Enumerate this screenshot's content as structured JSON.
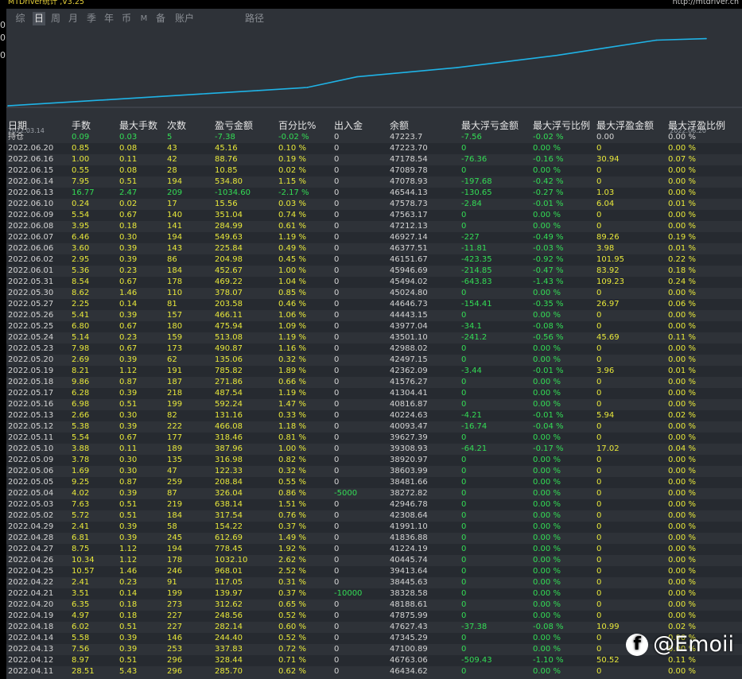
{
  "app": {
    "title": "MTDriver统计 ,V3.25",
    "url": "http://mtdriver.cn"
  },
  "side_labels": [
    "0",
    "0",
    "0"
  ],
  "tabs": [
    {
      "label": "综",
      "active": false
    },
    {
      "label": "日",
      "active": true
    },
    {
      "label": "周",
      "active": false
    },
    {
      "label": "月",
      "active": false
    },
    {
      "label": "季",
      "active": false
    },
    {
      "label": "年",
      "active": false
    },
    {
      "label": "币",
      "active": false
    },
    {
      "label": "M",
      "active": false
    },
    {
      "label": "备",
      "active": false
    },
    {
      "label": "账户",
      "active": false
    },
    {
      "label": "路径",
      "active": false
    }
  ],
  "chart_data": {
    "type": "line",
    "start_label": "2022.03.14",
    "end_label": "2022.06.20",
    "line_color": "#1fb3e6",
    "x": [
      "2022.03.14",
      "2022.03.21",
      "2022.03.28",
      "2022.04.04",
      "2022.04.11",
      "2022.04.18",
      "2022.04.25",
      "2022.05.02",
      "2022.05.09",
      "2022.05.16",
      "2022.05.23",
      "2022.05.30",
      "2022.06.06",
      "2022.06.13",
      "2022.06.20"
    ],
    "series": [
      {
        "values": [
          0.02,
          0.06,
          0.1,
          0.14,
          0.18,
          0.22,
          0.26,
          0.4,
          0.46,
          0.52,
          0.6,
          0.68,
          0.78,
          0.88,
          0.9
        ]
      }
    ]
  },
  "columns": [
    "日期",
    "手数",
    "最大手数",
    "次数",
    "盈亏金额",
    "百分比%",
    "出入金",
    "余额",
    "最大浮亏金额",
    "最大浮亏比例",
    "最大浮盈金额",
    "最大浮盈比例"
  ],
  "colors": {
    "yellow": "#e8e83a",
    "green": "#33dd55",
    "white": "#d4d4d4"
  },
  "rows": [
    [
      "持仓",
      "0.09",
      "0.03",
      "5",
      "-7.38",
      "-0.02 %",
      "0",
      "47223.7",
      "-7.56",
      "-0.02 %",
      "0.00",
      "0.00 %"
    ],
    [
      "2022.06.20",
      "0.85",
      "0.08",
      "43",
      "45.16",
      "0.10 %",
      "0",
      "47223.70",
      "0",
      "0.00 %",
      "0",
      "0.00 %"
    ],
    [
      "2022.06.16",
      "1.00",
      "0.11",
      "42",
      "88.76",
      "0.19 %",
      "0",
      "47178.54",
      "-76.36",
      "-0.16 %",
      "30.94",
      "0.07 %"
    ],
    [
      "2022.06.15",
      "0.55",
      "0.08",
      "28",
      "10.85",
      "0.02 %",
      "0",
      "47089.78",
      "0",
      "0.00 %",
      "0",
      "0.00 %"
    ],
    [
      "2022.06.14",
      "7.95",
      "0.51",
      "194",
      "534.80",
      "1.15 %",
      "0",
      "47078.93",
      "-197.68",
      "-0.42 %",
      "0",
      "0.00 %"
    ],
    [
      "2022.06.13",
      "16.77",
      "2.47",
      "209",
      "-1034.60",
      "-2.17 %",
      "0",
      "46544.13",
      "-130.65",
      "-0.27 %",
      "1.03",
      "0.00 %"
    ],
    [
      "2022.06.10",
      "0.24",
      "0.02",
      "17",
      "15.56",
      "0.03 %",
      "0",
      "47578.73",
      "-2.84",
      "-0.01 %",
      "6.04",
      "0.01 %"
    ],
    [
      "2022.06.09",
      "5.54",
      "0.67",
      "140",
      "351.04",
      "0.74 %",
      "0",
      "47563.17",
      "0",
      "0.00 %",
      "0",
      "0.00 %"
    ],
    [
      "2022.06.08",
      "3.95",
      "0.18",
      "141",
      "284.99",
      "0.61 %",
      "0",
      "47212.13",
      "0",
      "0.00 %",
      "0",
      "0.00 %"
    ],
    [
      "2022.06.07",
      "6.46",
      "0.30",
      "194",
      "549.63",
      "1.19 %",
      "0",
      "46927.14",
      "-227",
      "-0.49 %",
      "89.26",
      "0.19 %"
    ],
    [
      "2022.06.06",
      "3.60",
      "0.39",
      "143",
      "225.84",
      "0.49 %",
      "0",
      "46377.51",
      "-11.81",
      "-0.03 %",
      "3.98",
      "0.01 %"
    ],
    [
      "2022.06.02",
      "2.95",
      "0.39",
      "86",
      "204.98",
      "0.45 %",
      "0",
      "46151.67",
      "-423.35",
      "-0.92 %",
      "101.95",
      "0.22 %"
    ],
    [
      "2022.06.01",
      "5.36",
      "0.23",
      "184",
      "452.67",
      "1.00 %",
      "0",
      "45946.69",
      "-214.85",
      "-0.47 %",
      "83.92",
      "0.18 %"
    ],
    [
      "2022.05.31",
      "8.54",
      "0.67",
      "178",
      "469.22",
      "1.04 %",
      "0",
      "45494.02",
      "-643.83",
      "-1.43 %",
      "109.23",
      "0.24 %"
    ],
    [
      "2022.05.30",
      "8.62",
      "1.46",
      "110",
      "378.07",
      "0.85 %",
      "0",
      "45024.80",
      "0",
      "0.00 %",
      "0",
      "0.00 %"
    ],
    [
      "2022.05.27",
      "2.25",
      "0.14",
      "81",
      "203.58",
      "0.46 %",
      "0",
      "44646.73",
      "-154.41",
      "-0.35 %",
      "26.97",
      "0.06 %"
    ],
    [
      "2022.05.26",
      "5.41",
      "0.39",
      "157",
      "466.11",
      "1.06 %",
      "0",
      "44443.15",
      "0",
      "0.00 %",
      "0",
      "0.00 %"
    ],
    [
      "2022.05.25",
      "6.80",
      "0.67",
      "180",
      "475.94",
      "1.09 %",
      "0",
      "43977.04",
      "-34.1",
      "-0.08 %",
      "0",
      "0.00 %"
    ],
    [
      "2022.05.24",
      "5.14",
      "0.23",
      "159",
      "513.08",
      "1.19 %",
      "0",
      "43501.10",
      "-241.2",
      "-0.56 %",
      "45.69",
      "0.11 %"
    ],
    [
      "2022.05.23",
      "7.98",
      "0.67",
      "173",
      "490.87",
      "1.16 %",
      "0",
      "42988.02",
      "0",
      "0.00 %",
      "0",
      "0.00 %"
    ],
    [
      "2022.05.20",
      "2.69",
      "0.39",
      "62",
      "135.06",
      "0.32 %",
      "0",
      "42497.15",
      "0",
      "0.00 %",
      "0",
      "0.00 %"
    ],
    [
      "2022.05.19",
      "8.21",
      "1.12",
      "191",
      "785.82",
      "1.89 %",
      "0",
      "42362.09",
      "-3.44",
      "-0.01 %",
      "3.96",
      "0.01 %"
    ],
    [
      "2022.05.18",
      "9.86",
      "0.87",
      "187",
      "271.86",
      "0.66 %",
      "0",
      "41576.27",
      "0",
      "0.00 %",
      "0",
      "0.00 %"
    ],
    [
      "2022.05.17",
      "6.28",
      "0.39",
      "218",
      "487.54",
      "1.19 %",
      "0",
      "41304.41",
      "0",
      "0.00 %",
      "0",
      "0.00 %"
    ],
    [
      "2022.05.16",
      "6.98",
      "0.51",
      "199",
      "592.24",
      "1.47 %",
      "0",
      "40816.87",
      "0",
      "0.00 %",
      "0",
      "0.00 %"
    ],
    [
      "2022.05.13",
      "2.66",
      "0.30",
      "82",
      "131.16",
      "0.33 %",
      "0",
      "40224.63",
      "-4.21",
      "-0.01 %",
      "5.94",
      "0.02 %"
    ],
    [
      "2022.05.12",
      "5.38",
      "0.39",
      "222",
      "466.08",
      "1.18 %",
      "0",
      "40093.47",
      "-16.74",
      "-0.04 %",
      "0",
      "0.00 %"
    ],
    [
      "2022.05.11",
      "5.54",
      "0.67",
      "177",
      "318.46",
      "0.81 %",
      "0",
      "39627.39",
      "0",
      "0.00 %",
      "0",
      "0.00 %"
    ],
    [
      "2022.05.10",
      "3.88",
      "0.11",
      "189",
      "387.96",
      "1.00 %",
      "0",
      "39308.93",
      "-64.21",
      "-0.17 %",
      "17.02",
      "0.04 %"
    ],
    [
      "2022.05.09",
      "3.78",
      "0.30",
      "135",
      "316.98",
      "0.82 %",
      "0",
      "38920.97",
      "0",
      "0.00 %",
      "0",
      "0.00 %"
    ],
    [
      "2022.05.06",
      "1.69",
      "0.30",
      "47",
      "122.33",
      "0.32 %",
      "0",
      "38603.99",
      "0",
      "0.00 %",
      "0",
      "0.00 %"
    ],
    [
      "2022.05.05",
      "9.25",
      "0.87",
      "259",
      "208.84",
      "0.55 %",
      "0",
      "38481.66",
      "0",
      "0.00 %",
      "0",
      "0.00 %"
    ],
    [
      "2022.05.04",
      "4.02",
      "0.39",
      "87",
      "326.04",
      "0.86 %",
      "-5000",
      "38272.82",
      "0",
      "0.00 %",
      "0",
      "0.00 %"
    ],
    [
      "2022.05.03",
      "7.63",
      "0.51",
      "219",
      "638.14",
      "1.51 %",
      "0",
      "42946.78",
      "0",
      "0.00 %",
      "0",
      "0.00 %"
    ],
    [
      "2022.05.02",
      "5.72",
      "0.51",
      "184",
      "317.54",
      "0.76 %",
      "0",
      "42308.64",
      "0",
      "0.00 %",
      "0",
      "0.00 %"
    ],
    [
      "2022.04.29",
      "2.41",
      "0.39",
      "58",
      "154.22",
      "0.37 %",
      "0",
      "41991.10",
      "0",
      "0.00 %",
      "0",
      "0.00 %"
    ],
    [
      "2022.04.28",
      "6.81",
      "0.39",
      "245",
      "612.69",
      "1.49 %",
      "0",
      "41836.88",
      "0",
      "0.00 %",
      "0",
      "0.00 %"
    ],
    [
      "2022.04.27",
      "8.75",
      "1.12",
      "194",
      "778.45",
      "1.92 %",
      "0",
      "41224.19",
      "0",
      "0.00 %",
      "0",
      "0.00 %"
    ],
    [
      "2022.04.26",
      "10.34",
      "1.12",
      "178",
      "1032.10",
      "2.62 %",
      "0",
      "40445.74",
      "0",
      "0.00 %",
      "0",
      "0.00 %"
    ],
    [
      "2022.04.25",
      "10.57",
      "1.46",
      "246",
      "968.01",
      "2.52 %",
      "0",
      "39413.64",
      "0",
      "0.00 %",
      "0",
      "0.00 %"
    ],
    [
      "2022.04.22",
      "2.41",
      "0.23",
      "91",
      "117.05",
      "0.31 %",
      "0",
      "38445.63",
      "0",
      "0.00 %",
      "0",
      "0.00 %"
    ],
    [
      "2022.04.21",
      "3.51",
      "0.14",
      "199",
      "139.97",
      "0.37 %",
      "-10000",
      "38328.58",
      "0",
      "0.00 %",
      "0",
      "0.00 %"
    ],
    [
      "2022.04.20",
      "6.35",
      "0.18",
      "273",
      "312.62",
      "0.65 %",
      "0",
      "48188.61",
      "0",
      "0.00 %",
      "0",
      "0.00 %"
    ],
    [
      "2022.04.19",
      "4.97",
      "0.18",
      "227",
      "248.56",
      "0.52 %",
      "0",
      "47875.99",
      "0",
      "0.00 %",
      "0",
      "0.00 %"
    ],
    [
      "2022.04.18",
      "6.02",
      "0.51",
      "227",
      "282.14",
      "0.60 %",
      "0",
      "47627.43",
      "-37.38",
      "-0.08 %",
      "10.99",
      "0.02 %"
    ],
    [
      "2022.04.14",
      "5.58",
      "0.39",
      "146",
      "244.40",
      "0.52 %",
      "0",
      "47345.29",
      "0",
      "0.00 %",
      "0",
      "0.00 %"
    ],
    [
      "2022.04.13",
      "7.56",
      "0.39",
      "253",
      "337.83",
      "0.72 %",
      "0",
      "47100.89",
      "0",
      "0.00 %",
      "0",
      "0.00 %"
    ],
    [
      "2022.04.12",
      "8.97",
      "0.51",
      "296",
      "328.44",
      "0.71 %",
      "0",
      "46763.06",
      "-509.43",
      "-1.10 %",
      "50.52",
      "0.11 %"
    ],
    [
      "2022.04.11",
      "28.51",
      "5.43",
      "296",
      "285.70",
      "0.62 %",
      "0",
      "46434.62",
      "0",
      "0.00 %",
      "0",
      "0.00 %"
    ]
  ],
  "watermark": {
    "text": "@Emoii",
    "logo": "f"
  }
}
